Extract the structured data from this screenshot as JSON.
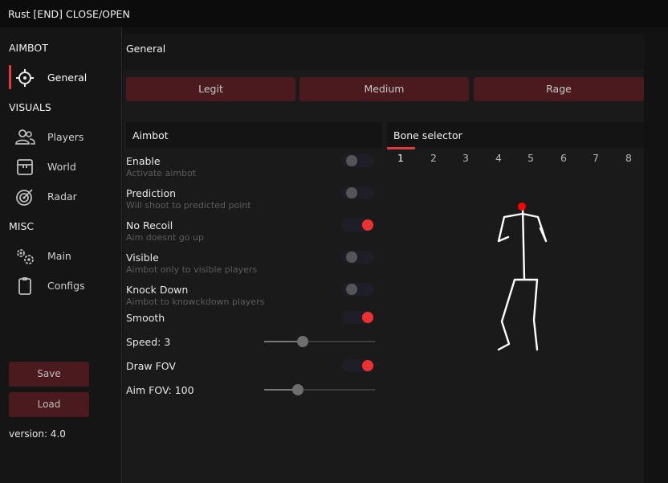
{
  "window": {
    "title": "Rust [END] CLOSE/OPEN"
  },
  "sidebar": {
    "sections": [
      {
        "label": "AIMBOT",
        "items": [
          {
            "label": "General",
            "icon": "crosshair-icon",
            "active": true
          }
        ]
      },
      {
        "label": "VISUALS",
        "items": [
          {
            "label": "Players",
            "icon": "users-icon"
          },
          {
            "label": "World",
            "icon": "box-icon"
          },
          {
            "label": "Radar",
            "icon": "radar-icon"
          }
        ]
      },
      {
        "label": "MISC",
        "items": [
          {
            "label": "Main",
            "icon": "gears-icon"
          },
          {
            "label": "Configs",
            "icon": "clipboard-icon"
          }
        ]
      }
    ],
    "save_label": "Save",
    "load_label": "Load",
    "version": "version: 4.0"
  },
  "main": {
    "header": "General",
    "presets": [
      "Legit",
      "Medium",
      "Rage"
    ],
    "aimbot_panel": {
      "title": "Aimbot",
      "options": [
        {
          "label": "Enable",
          "description": "Activate aimbot",
          "enabled": false
        },
        {
          "label": "Prediction",
          "description": "Will shoot to predicted point",
          "enabled": false
        },
        {
          "label": "No Recoil",
          "description": "Aim doesnt go up",
          "enabled": true
        },
        {
          "label": "Visible",
          "description": "Aimbot only to visible players",
          "enabled": false
        },
        {
          "label": "Knock Down",
          "description": "Aimbot to knowckdown players",
          "enabled": false
        },
        {
          "label": "Smooth",
          "enabled": true
        }
      ],
      "speed": {
        "label": "Speed: 3",
        "value": 3,
        "fraction": 0.33
      },
      "draw_fov": {
        "label": "Draw FOV",
        "enabled": true
      },
      "aim_fov": {
        "label": "Aim FOV: 100",
        "value": 100,
        "fraction": 0.28
      }
    },
    "bone_panel": {
      "title": "Bone selector",
      "tabs": [
        "1",
        "2",
        "3",
        "4",
        "5",
        "6",
        "7",
        "8"
      ],
      "active_tab": "1"
    }
  },
  "colors": {
    "accent": "#e23a3a",
    "button_bg": "#4a1a1e",
    "toggle_on": "#ef3030",
    "panel_bg": "#1a1a1a"
  }
}
